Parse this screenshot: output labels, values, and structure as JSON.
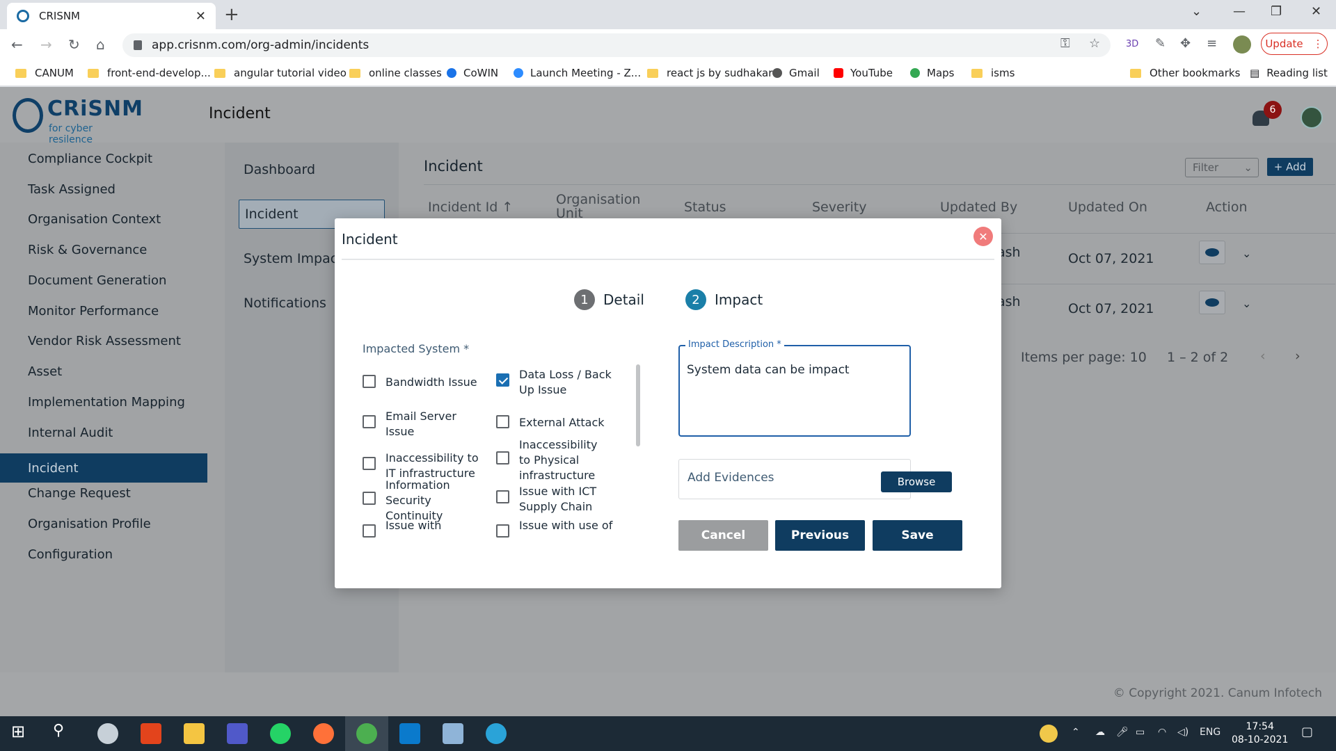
{
  "browser": {
    "tab_title": "CRISNM",
    "url": "app.crisnm.com/org-admin/incidents",
    "update_label": "Update",
    "bookmarks": [
      "CANUM",
      "front-end-develop...",
      "angular tutorial video",
      "online classes",
      "CoWIN",
      "Launch Meeting - Z...",
      "react js by sudhakar",
      "Gmail",
      "YouTube",
      "Maps",
      "isms",
      "Other bookmarks",
      "Reading list"
    ]
  },
  "app": {
    "logo_name": "CRiSNM",
    "logo_tagline": "for cyber resilence",
    "header_title": "Incident",
    "notification_count": "6",
    "sidebar": [
      "Compliance Cockpit",
      "Task Assigned",
      "Organisation Context",
      "Risk & Governance",
      "Document Generation",
      "Monitor Performance",
      "Vendor Risk Assessment",
      "Asset",
      "Implementation Mapping",
      "Internal Audit",
      "Incident",
      "Change Request",
      "Organisation Profile",
      "Configuration"
    ],
    "subnav": [
      "Dashboard",
      "Incident",
      "System Impac",
      "Notifications"
    ],
    "content_title": "Incident",
    "filter_label": "Filter",
    "add_label": "+ Add",
    "table_headers": [
      "Incident Id",
      "Organisation Unit",
      "Status",
      "Severity",
      "Updated By",
      "Updated On",
      "Action"
    ],
    "rows": [
      {
        "updated_by": "ash",
        "updated_on": "Oct 07, 2021"
      },
      {
        "updated_by": "ash",
        "updated_on": "Oct 07, 2021"
      }
    ],
    "items_per_page": "Items per page: 10",
    "range": "1 – 2 of 2",
    "copyright": "© Copyright 2021. Canum Infotech"
  },
  "modal": {
    "title": "Incident",
    "steps": [
      {
        "num": "1",
        "label": "Detail"
      },
      {
        "num": "2",
        "label": "Impact"
      }
    ],
    "impacted_label": "Impacted System *",
    "options": [
      {
        "label": "Bandwidth Issue",
        "checked": false
      },
      {
        "label": "Data Loss / Back Up Issue",
        "checked": true
      },
      {
        "label": "Email Server Issue",
        "checked": false
      },
      {
        "label": "External Attack",
        "checked": false
      },
      {
        "label": "Inaccessibility to IT infrastructure",
        "checked": false
      },
      {
        "label": "Inaccessibility to Physical infrastructure",
        "checked": false
      },
      {
        "label": "Information Security Continuity",
        "checked": false
      },
      {
        "label": "Issue with ICT Supply Chain",
        "checked": false
      },
      {
        "label": "Issue with",
        "checked": false
      },
      {
        "label": "Issue with use of",
        "checked": false
      }
    ],
    "impact_label": "Impact Description *",
    "impact_value": "System data can be impact",
    "evidence_label": "Add Evidences",
    "browse_label": "Browse",
    "cancel_label": "Cancel",
    "previous_label": "Previous",
    "save_label": "Save"
  },
  "taskbar": {
    "lang": "ENG",
    "time": "17:54",
    "date": "08-10-2021"
  },
  "colors": {
    "brand": "#0f3c60",
    "step_active": "#1a7fa8",
    "step_inactive": "#6d6f72",
    "close": "#f07b7b"
  }
}
